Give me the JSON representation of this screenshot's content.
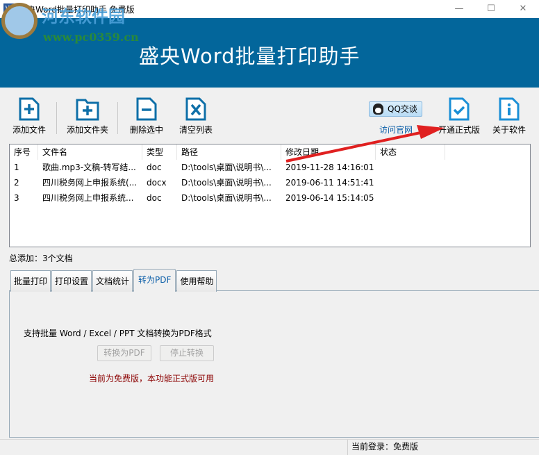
{
  "window": {
    "title": "盛央Word批量打印助手 免费版",
    "app_icon": "W",
    "minimize": "—",
    "maximize": "☐",
    "close": "✕"
  },
  "banner": {
    "title": "盛央Word批量打印助手"
  },
  "watermark": {
    "name": "河东软件园",
    "url": "www.pc0359.cn"
  },
  "toolbar": {
    "add_file": "添加文件",
    "add_folder": "添加文件夹",
    "delete_selected": "删除选中",
    "clear_list": "清空列表",
    "qq_chat": "QQ交谈",
    "visit_site": "访问官网",
    "upgrade": "开通正式版",
    "about": "关于软件"
  },
  "list": {
    "columns": [
      "序号",
      "文件名",
      "类型",
      "路径",
      "修改日期",
      "状态"
    ],
    "rows": [
      [
        "1",
        "歌曲.mp3-文稿-转写结...",
        "doc",
        "D:\\tools\\桌面\\说明书\\...",
        "2019-11-28 14:16:01",
        ""
      ],
      [
        "2",
        "四川税务网上申报系统(...",
        "docx",
        "D:\\tools\\桌面\\说明书\\...",
        "2019-06-11 14:51:41",
        ""
      ],
      [
        "3",
        "四川税务网上申报系统...",
        "doc",
        "D:\\tools\\桌面\\说明书\\...",
        "2019-06-14 15:14:05",
        ""
      ]
    ]
  },
  "summary": "总添加：3个文档",
  "tabs": [
    "批量打印",
    "打印设置",
    "文档统计",
    "转为PDF",
    "使用帮助"
  ],
  "pdf_panel": {
    "description": "支持批量 Word / Excel / PPT 文档转换为PDF格式",
    "convert_button": "转换为PDF",
    "stop_button": "停止转换",
    "notice": "当前为免费版，本功能正式版可用"
  },
  "status": {
    "login": "当前登录：免费版"
  },
  "colors": {
    "banner": "#03669b",
    "icon": "#0e6fa8",
    "notice": "#8b0000",
    "arrow": "#e02020"
  }
}
